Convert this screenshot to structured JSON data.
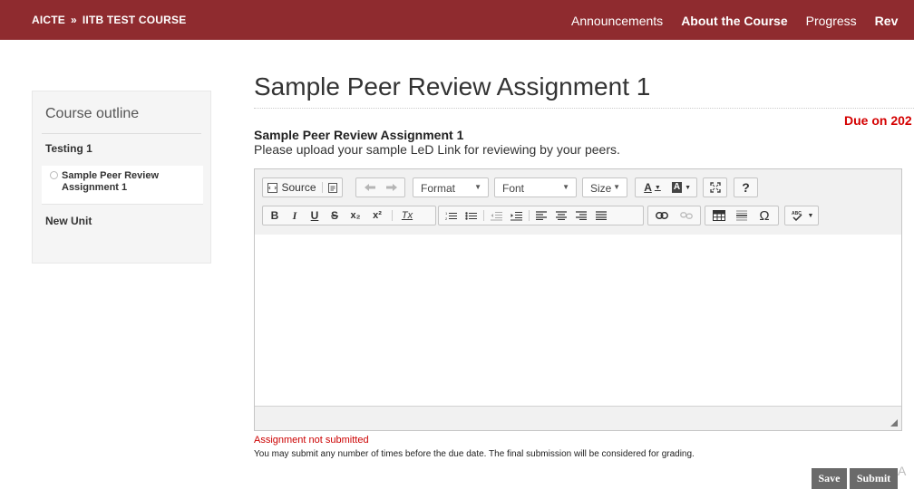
{
  "header": {
    "crumb_org": "AICTE",
    "crumb_sep": "»",
    "crumb_course": "IITB TEST COURSE",
    "nav": [
      "Announcements",
      "About the Course",
      "Progress",
      "Rev"
    ]
  },
  "sidebar": {
    "title": "Course outline",
    "section1": "Testing 1",
    "item": "Sample Peer Review Assignment 1",
    "section2": "New Unit"
  },
  "main": {
    "title": "Sample Peer Review Assignment 1",
    "due": "Due on 202",
    "subtitle": "Sample Peer Review Assignment 1",
    "instructions": "Please upload your sample LeD Link for reviewing by your peers.",
    "status": "Assignment not submitted",
    "note": "You may submit any number of times before the due date. The final submission will be considered for grading.",
    "save": "Save",
    "submit": "Submit",
    "watermark": "A"
  },
  "toolbar": {
    "source": "Source",
    "format": "Format",
    "font": "Font",
    "size": "Size",
    "help": "?",
    "bold": "B",
    "italic": "I",
    "underline": "U",
    "strike": "S",
    "subscript": "x₂",
    "superscript": "x²",
    "remove_format": "Tx",
    "text_color": "A",
    "bg_color": "A"
  },
  "colors": {
    "header_bg": "#8f2b2f",
    "due_red": "#d40000",
    "button_gray": "#6a6a6a"
  }
}
